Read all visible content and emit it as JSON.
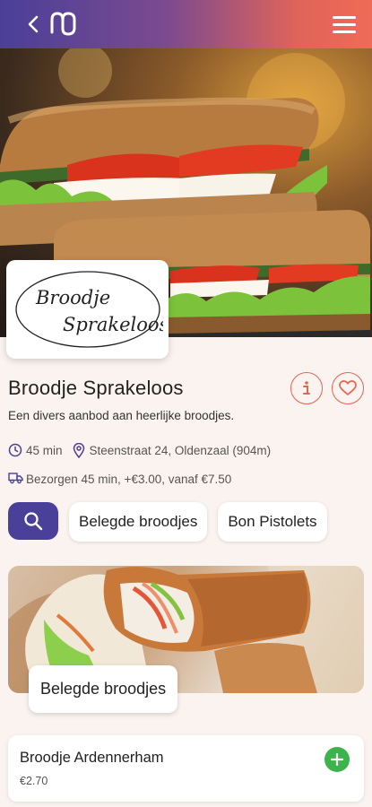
{
  "header": {
    "back_icon": "chevron-left-icon",
    "logo_icon": "app-logo-icon",
    "menu_icon": "hamburger-menu-icon",
    "gradient": [
      "#4a3f99",
      "#ef6b55"
    ]
  },
  "hero": {
    "image": "sandwich-photo"
  },
  "brand": {
    "logo_text_line1": "Broodje",
    "logo_text_line2": "Sprakeloos"
  },
  "restaurant": {
    "name": "Broodje Sprakeloos",
    "description": "Een divers aanbod aan heerlijke broodjes.",
    "time": "45 min",
    "address": "Steenstraat 24, Oldenzaal (904m)",
    "delivery": "Bezorgen 45 min,  +€3.00,  vanaf €7.50"
  },
  "actions": {
    "info_icon": "info-icon",
    "favorite_icon": "heart-icon",
    "accent": "#e8634e"
  },
  "categories": {
    "search_icon": "search-icon",
    "search_color": "#4a3f99",
    "items": [
      "Belegde broodjes",
      "Bon Pistolets"
    ]
  },
  "section": {
    "title": "Belegde broodjes",
    "image": "baguette-photo"
  },
  "products": [
    {
      "name": "Broodje Ardennerham",
      "price": "€2.70",
      "add_icon": "plus-icon",
      "add_color": "#3cb44b"
    }
  ]
}
